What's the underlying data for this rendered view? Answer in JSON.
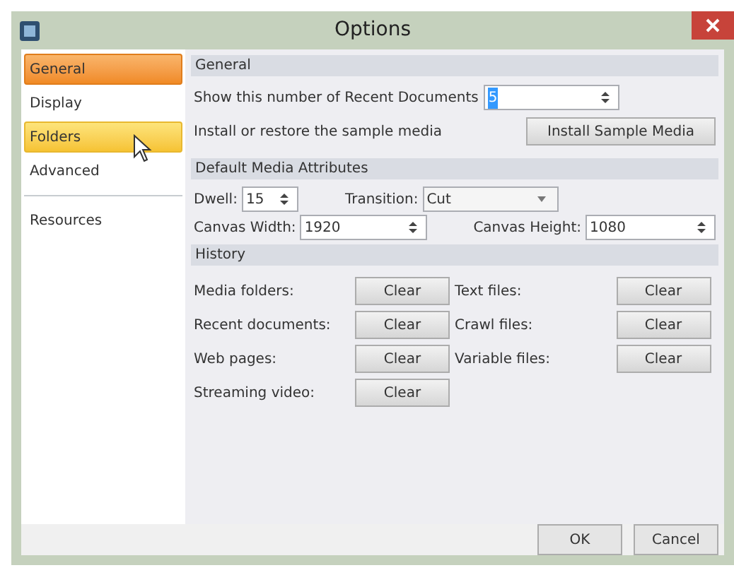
{
  "window": {
    "title": "Options"
  },
  "sidebar": {
    "items": [
      {
        "label": "General",
        "selected": true,
        "hovered": false
      },
      {
        "label": "Display",
        "selected": false,
        "hovered": false
      },
      {
        "label": "Folders",
        "selected": false,
        "hovered": true
      },
      {
        "label": "Advanced",
        "selected": false,
        "hovered": false
      }
    ],
    "footer_items": [
      {
        "label": "Resources",
        "selected": false,
        "hovered": false
      }
    ]
  },
  "general": {
    "title": "General",
    "recent_label": "Show this number of Recent Documents",
    "recent_value": "5",
    "sample_label": "Install or restore the sample media",
    "sample_button": "Install Sample Media"
  },
  "media": {
    "title": "Default Media Attributes",
    "dwell_label": "Dwell:",
    "dwell_value": "15",
    "transition_label": "Transition:",
    "transition_value": "Cut",
    "width_label": "Canvas Width:",
    "width_value": "1920",
    "height_label": "Canvas Height:",
    "height_value": "1080"
  },
  "history": {
    "title": "History",
    "rows": [
      {
        "label": "Media folders:",
        "button": "Clear"
      },
      {
        "label": "Text files:",
        "button": "Clear"
      },
      {
        "label": "Recent documents:",
        "button": "Clear"
      },
      {
        "label": "Crawl files:",
        "button": "Clear"
      },
      {
        "label": "Web pages:",
        "button": "Clear"
      },
      {
        "label": "Variable files:",
        "button": "Clear"
      },
      {
        "label": "Streaming video:",
        "button": "Clear"
      }
    ]
  },
  "buttons": [
    "OK",
    "Cancel"
  ]
}
